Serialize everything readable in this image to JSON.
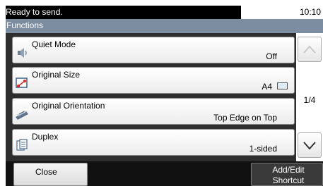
{
  "status": {
    "message": "Ready to send.",
    "time": "10:10"
  },
  "header": {
    "title": "Functions"
  },
  "items": [
    {
      "label": "Quiet Mode",
      "value": "Off",
      "icon": "speaker-icon"
    },
    {
      "label": "Original Size",
      "value": "A4",
      "icon": "original-size-icon"
    },
    {
      "label": "Original Orientation",
      "value": "Top Edge on Top",
      "icon": "orientation-icon"
    },
    {
      "label": "Duplex",
      "value": "1-sided",
      "icon": "duplex-icon"
    }
  ],
  "pagination": {
    "indicator": "1/4"
  },
  "footer": {
    "close_label": "Close",
    "shortcut_line1": "Add/Edit",
    "shortcut_line2": "Shortcut"
  }
}
